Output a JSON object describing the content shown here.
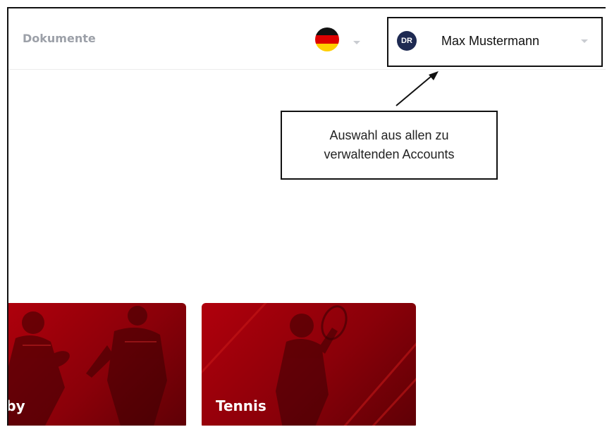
{
  "header": {
    "nav_dokumente": "Dokumente",
    "language": {
      "icon": "germany-flag-icon"
    },
    "account": {
      "avatar_initials": "DR",
      "name": "Max Mustermann"
    }
  },
  "annotation": {
    "callout_line1": "Auswahl aus allen zu",
    "callout_line2": "verwaltenden Accounts"
  },
  "cards": [
    {
      "label": "gby"
    },
    {
      "label": "Tennis"
    }
  ],
  "colors": {
    "accent_red": "#b0000c",
    "avatar_bg": "#1e2a52",
    "nav_text": "#9ca0a8"
  }
}
